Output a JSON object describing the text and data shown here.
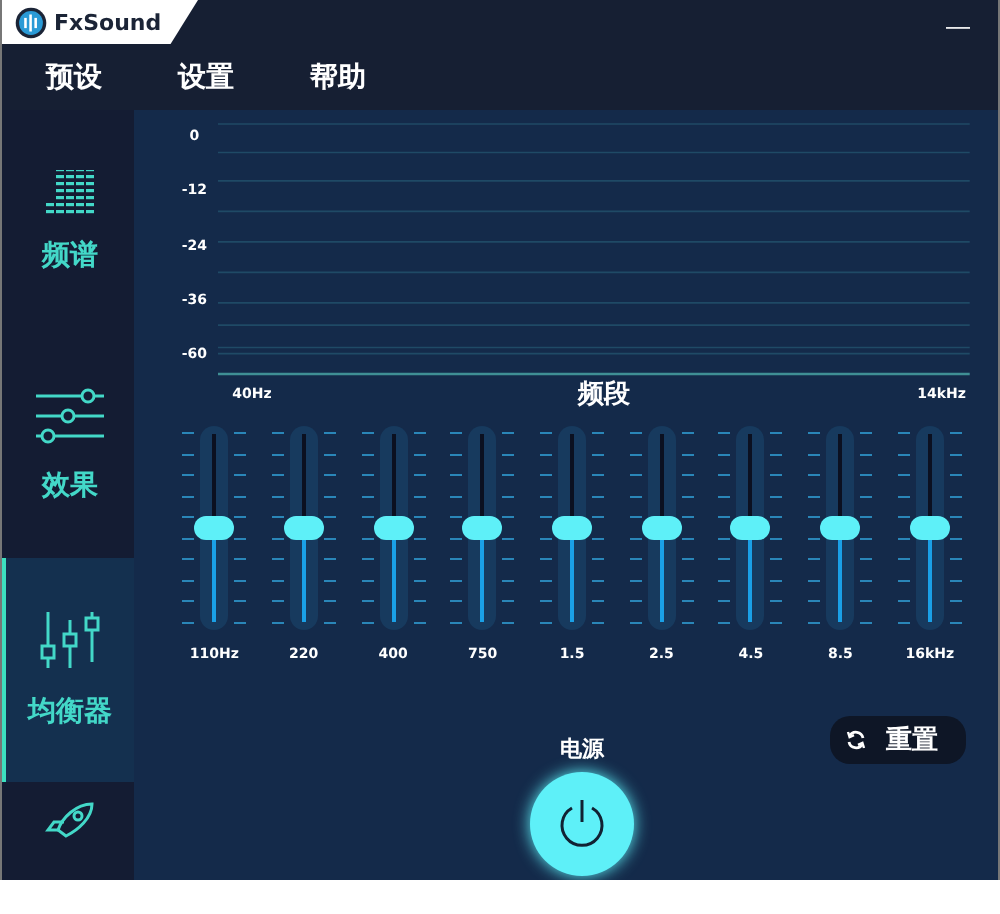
{
  "window": {
    "title": "FxSound",
    "close": "—"
  },
  "menu": [
    "预设",
    "设置",
    "帮助"
  ],
  "sidebar": {
    "items": [
      {
        "label": "频谱",
        "selected": false
      },
      {
        "label": "效果",
        "selected": false
      },
      {
        "label": "均衡器",
        "selected": true
      },
      {
        "selected": false
      }
    ]
  },
  "spectrum": {
    "db_labels": [
      "0",
      "-12",
      "-24",
      "-36",
      "-60"
    ],
    "low_label": "40Hz",
    "title": "频段",
    "high_label": "14kHz"
  },
  "bands": [
    {
      "label": "110Hz",
      "level": 0.5
    },
    {
      "label": "220",
      "level": 0.5
    },
    {
      "label": "400",
      "level": 0.5
    },
    {
      "label": "750",
      "level": 0.5
    },
    {
      "label": "1.5",
      "level": 0.5
    },
    {
      "label": "2.5",
      "level": 0.5
    },
    {
      "label": "4.5",
      "level": 0.5
    },
    {
      "label": "8.5",
      "level": 0.5
    },
    {
      "label": "16kHz",
      "level": 0.5
    }
  ],
  "power": {
    "label": "电源",
    "on": true
  },
  "reset_button": "重置"
}
